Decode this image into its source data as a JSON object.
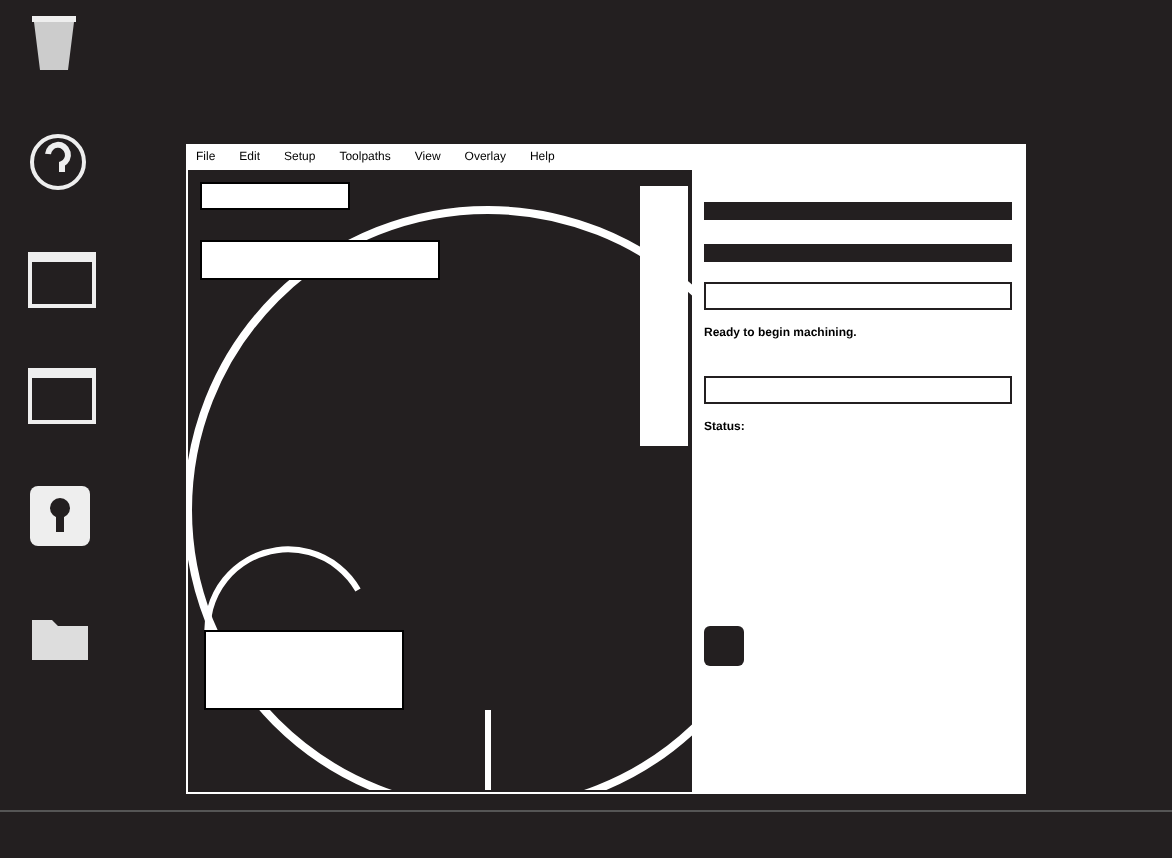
{
  "menu": [
    {
      "label": "File"
    },
    {
      "label": "Edit"
    },
    {
      "label": "Setup"
    },
    {
      "label": "Toolpaths"
    },
    {
      "label": "View"
    },
    {
      "label": "Overlay"
    },
    {
      "label": "Help"
    }
  ],
  "panel": {
    "message": "Ready to begin machining.",
    "status_label": "Status:"
  },
  "desktop_icons": [
    {
      "kind": "trash"
    },
    {
      "kind": "help"
    },
    {
      "kind": "window"
    },
    {
      "kind": "window"
    },
    {
      "kind": "app"
    },
    {
      "kind": "folder"
    }
  ]
}
